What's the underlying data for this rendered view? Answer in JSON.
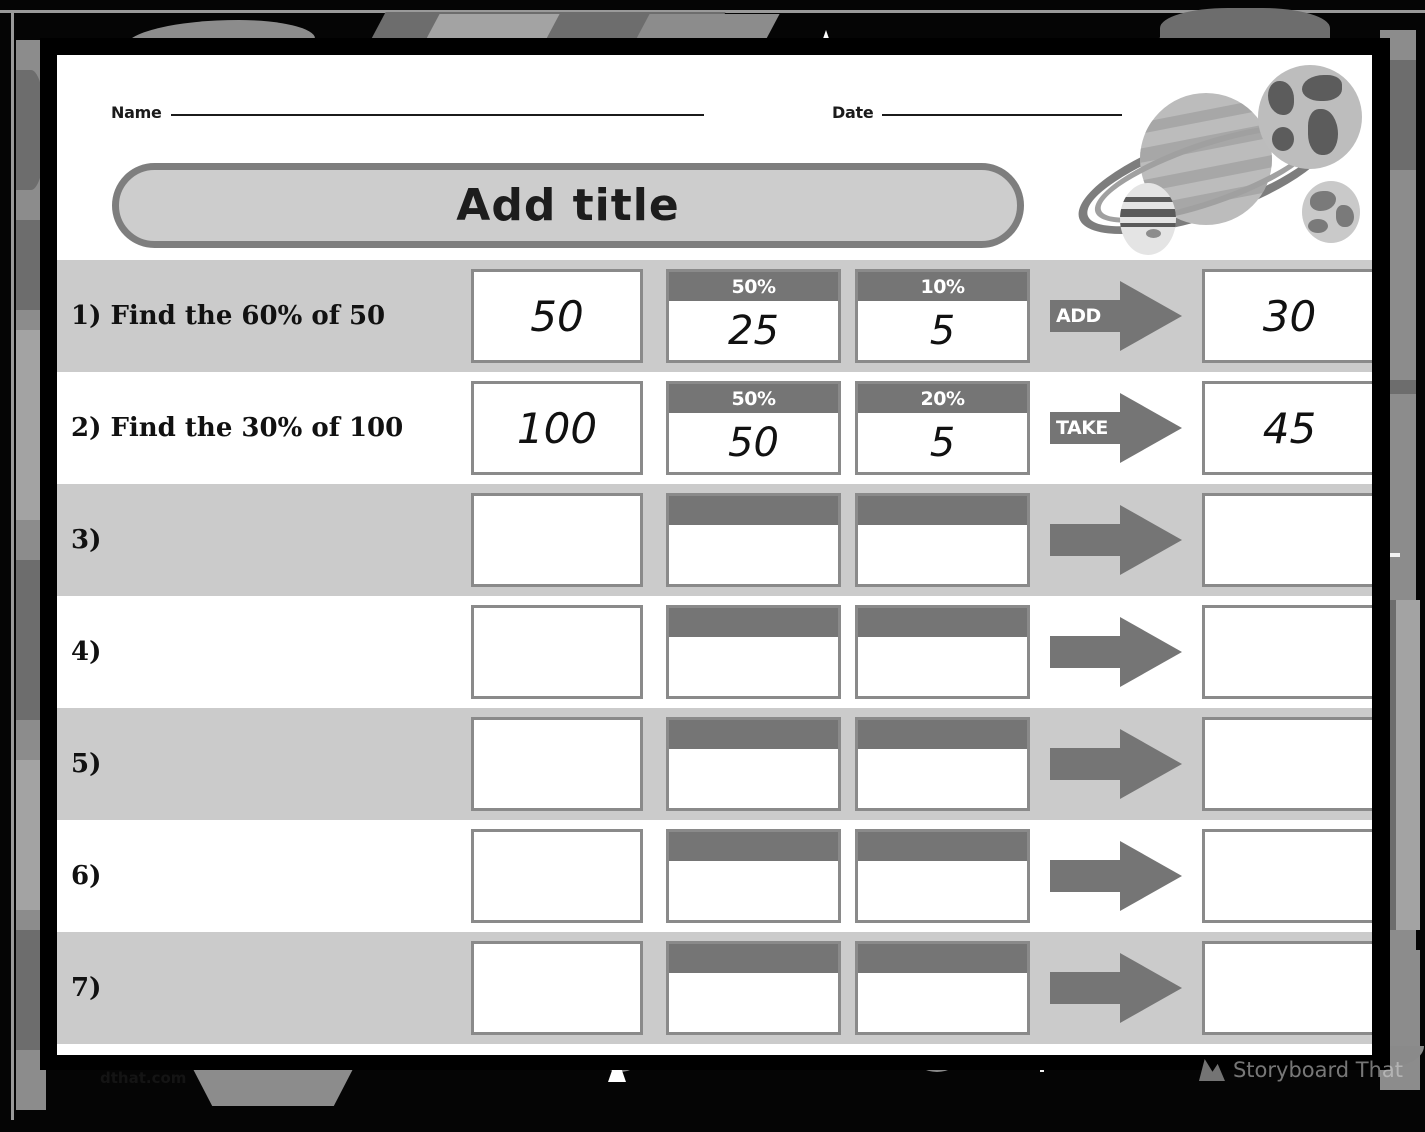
{
  "worksheet": {
    "name_label": "Name",
    "date_label": "Date",
    "title_placeholder": "Add title"
  },
  "columns": {
    "value_header": "",
    "pct_a_default": "50%",
    "pct_b_default": "10%"
  },
  "rows": [
    {
      "number": "1)",
      "question": "1) Find the 60% of 50",
      "value": "50",
      "pct_a_label": "50%",
      "pct_a_value": "25",
      "pct_b_label": "10%",
      "pct_b_value": "5",
      "operation": "ADD",
      "answer": "30",
      "shaded": true
    },
    {
      "number": "2)",
      "question": "2) Find the 30% of 100",
      "value": "100",
      "pct_a_label": "50%",
      "pct_a_value": "50",
      "pct_b_label": "20%",
      "pct_b_value": "5",
      "operation": "TAKE",
      "answer": "45",
      "shaded": false
    },
    {
      "number": "3)",
      "question": "3)",
      "value": "",
      "pct_a_label": "",
      "pct_a_value": "",
      "pct_b_label": "",
      "pct_b_value": "",
      "operation": "",
      "answer": "",
      "shaded": true
    },
    {
      "number": "4)",
      "question": "4)",
      "value": "",
      "pct_a_label": "",
      "pct_a_value": "",
      "pct_b_label": "",
      "pct_b_value": "",
      "operation": "",
      "answer": "",
      "shaded": false
    },
    {
      "number": "5)",
      "question": "5)",
      "value": "",
      "pct_a_label": "",
      "pct_a_value": "",
      "pct_b_label": "",
      "pct_b_value": "",
      "operation": "",
      "answer": "",
      "shaded": true
    },
    {
      "number": "6)",
      "question": "6)",
      "value": "",
      "pct_a_label": "",
      "pct_a_value": "",
      "pct_b_label": "",
      "pct_b_value": "",
      "operation": "",
      "answer": "",
      "shaded": false
    },
    {
      "number": "7)",
      "question": "7)",
      "value": "",
      "pct_a_label": "",
      "pct_a_value": "",
      "pct_b_label": "",
      "pct_b_value": "",
      "operation": "",
      "answer": "",
      "shaded": true
    }
  ],
  "footer": {
    "url": "dthat.com",
    "brand": "Storyboard That"
  },
  "colors": {
    "page": "#ffffff",
    "row_shaded": "#cbcbcb",
    "accent_gray": "#757575",
    "border_gray": "#8a8a8a",
    "title_fill": "#cdcdcd",
    "title_border": "#7e7e7e",
    "backdrop": "#050505"
  },
  "icons": {
    "arrow": "right-arrow-icon",
    "planets": "planets-illustration"
  }
}
